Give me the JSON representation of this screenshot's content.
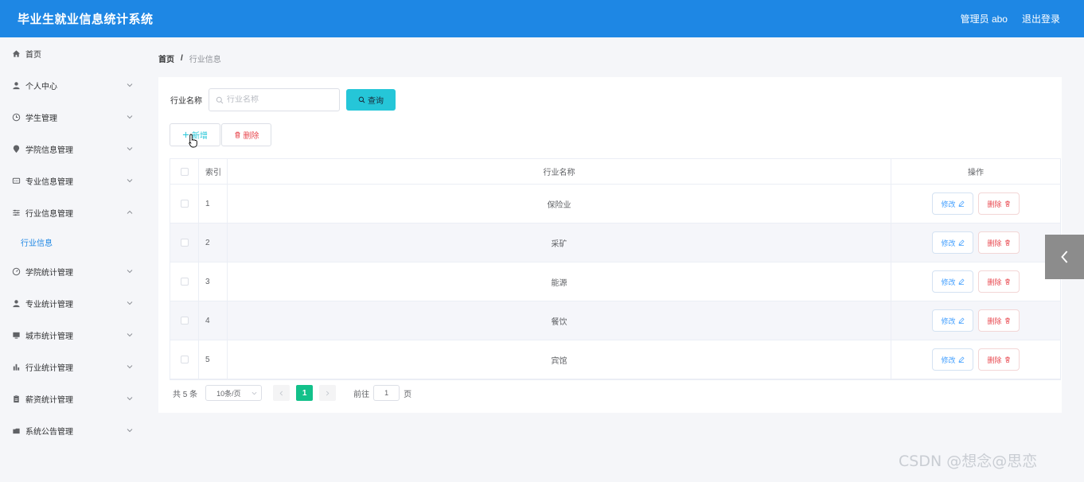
{
  "header": {
    "title": "毕业生就业信息统计系统",
    "user": "管理员 abo",
    "logout": "退出登录"
  },
  "sidebar": {
    "items": [
      {
        "label": "首页",
        "icon": "home-icon"
      },
      {
        "label": "个人中心",
        "icon": "user-icon"
      },
      {
        "label": "学生管理",
        "icon": "clock-icon"
      },
      {
        "label": "学院信息管理",
        "icon": "location-icon"
      },
      {
        "label": "专业信息管理",
        "icon": "message-icon"
      },
      {
        "label": "行业信息管理",
        "icon": "sliders-icon",
        "expanded": true
      },
      {
        "label": "学院统计管理",
        "icon": "gauge-icon"
      },
      {
        "label": "专业统计管理",
        "icon": "user-icon"
      },
      {
        "label": "城市统计管理",
        "icon": "monitor-icon"
      },
      {
        "label": "行业统计管理",
        "icon": "bar-chart-icon"
      },
      {
        "label": "薪资统计管理",
        "icon": "clipboard-icon"
      },
      {
        "label": "系统公告管理",
        "icon": "folder-icon"
      }
    ],
    "sub_active": "行业信息"
  },
  "breadcrumb": {
    "home": "首页",
    "sep": "/",
    "current": "行业信息"
  },
  "search": {
    "label": "行业名称",
    "placeholder": "行业名称",
    "query": "查询"
  },
  "toolbar": {
    "add": "新增",
    "delete": "删除"
  },
  "table": {
    "headers": {
      "index": "索引",
      "name": "行业名称",
      "op": "操作"
    },
    "rows": [
      {
        "index": "1",
        "name": "保险业"
      },
      {
        "index": "2",
        "name": "采矿"
      },
      {
        "index": "3",
        "name": "能源"
      },
      {
        "index": "4",
        "name": "餐饮"
      },
      {
        "index": "5",
        "name": "宾馆"
      }
    ],
    "edit_label": "修改",
    "delete_label": "删除"
  },
  "pagination": {
    "total": "共 5 条",
    "page_size": "10条/页",
    "current": "1",
    "goto_prefix": "前往",
    "goto_value": "1",
    "goto_suffix": "页"
  },
  "watermark": "CSDN @想念@思恋",
  "colors": {
    "header": "#1e87e4",
    "accent": "#25c6d8",
    "danger": "#e8484f",
    "page_active": "#13c18a"
  }
}
